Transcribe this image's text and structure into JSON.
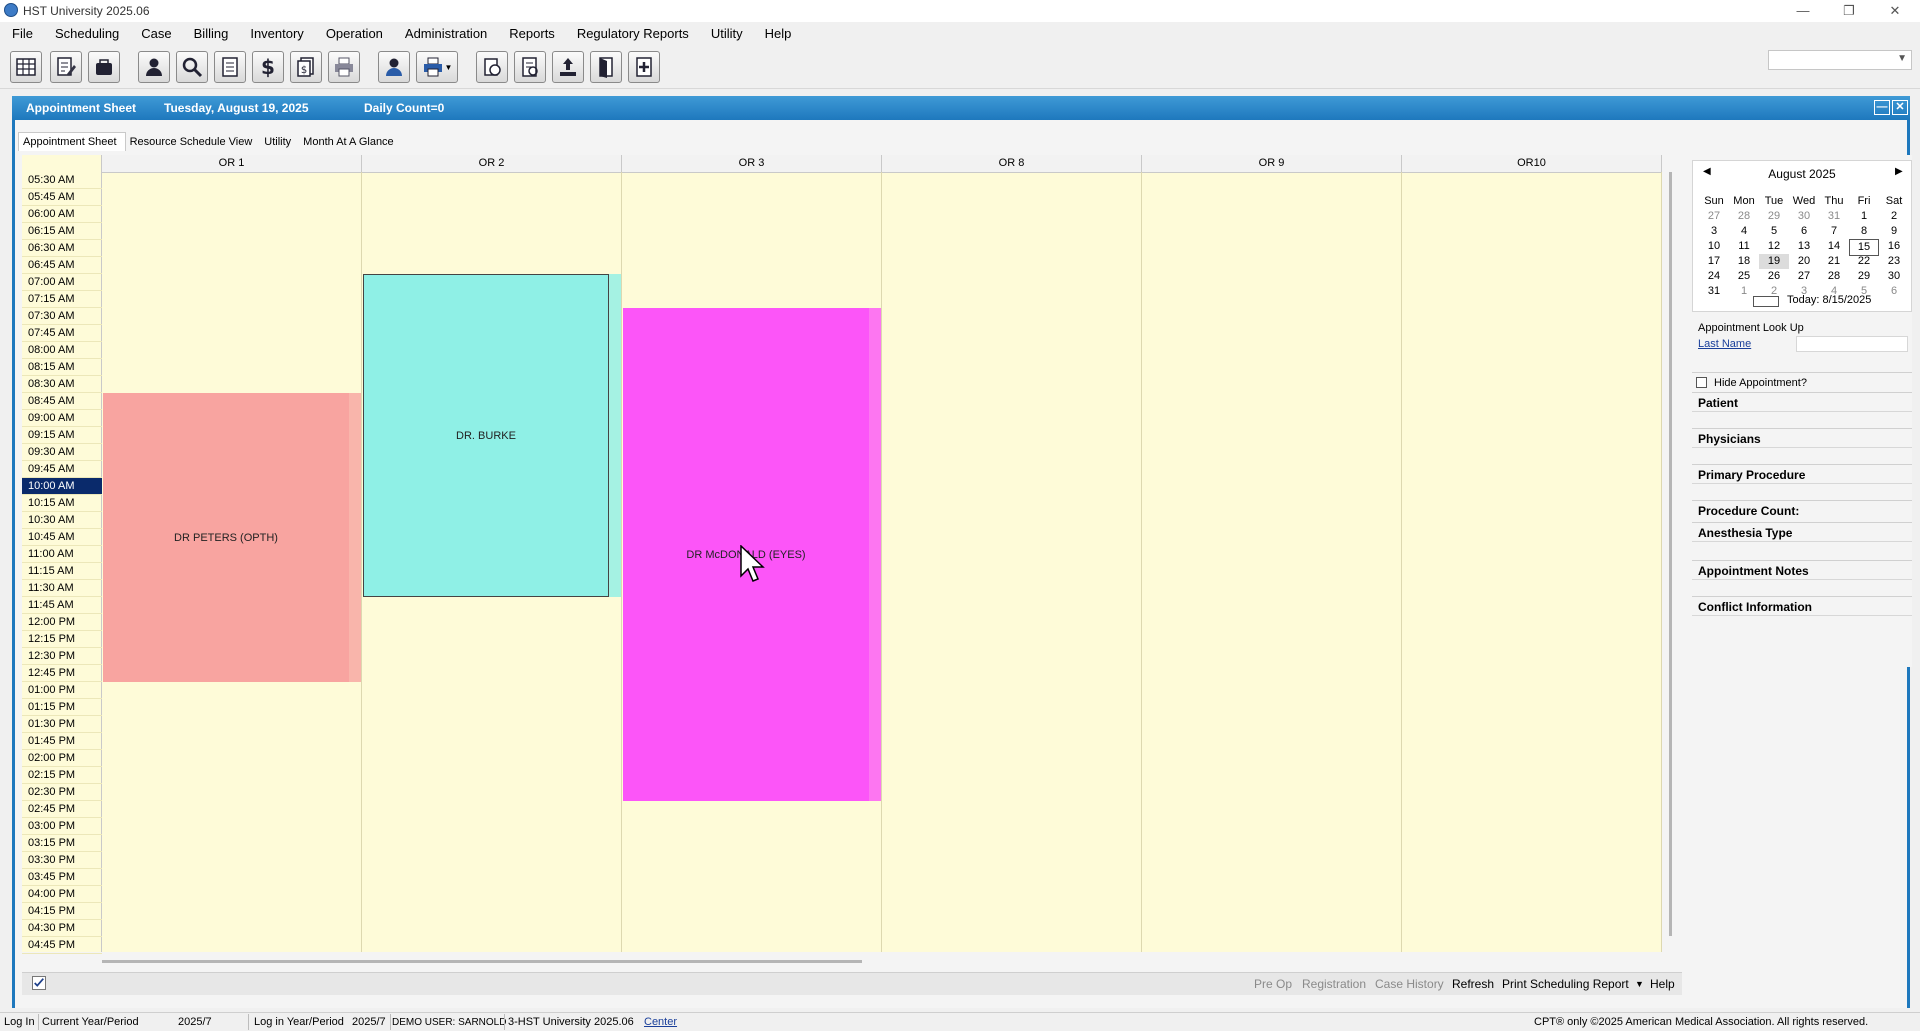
{
  "window": {
    "title": "HST University 2025.06"
  },
  "menu": [
    "File",
    "Scheduling",
    "Case",
    "Billing",
    "Inventory",
    "Operation",
    "Administration",
    "Reports",
    "Regulatory Reports",
    "Utility",
    "Help"
  ],
  "toolbar": {
    "icons": [
      "schedule-grid-icon",
      "edit-document-icon",
      "case-folder-icon",
      "patient-icon",
      "search-icon",
      "ledger-icon",
      "dollar-icon",
      "payments-icon",
      "print-icon",
      "physician-icon",
      "printer-dropdown-icon",
      "document-icon",
      "report-icon",
      "upload-icon",
      "exit-door-icon",
      "add-record-icon"
    ]
  },
  "appointment_sheet": {
    "header_title": "Appointment Sheet",
    "header_date": "Tuesday, August 19, 2025",
    "header_count": "Daily Count=0",
    "tabs": [
      "Appointment Sheet",
      "Resource Schedule View",
      "Utility",
      "Month At A Glance"
    ],
    "columns": [
      "OR 1",
      "OR 2",
      "OR 3",
      "OR 8",
      "OR 9",
      "OR10"
    ],
    "times": [
      "05:30 AM",
      "05:45 AM",
      "06:00 AM",
      "06:15 AM",
      "06:30 AM",
      "06:45 AM",
      "07:00 AM",
      "07:15 AM",
      "07:30 AM",
      "07:45 AM",
      "08:00 AM",
      "08:15 AM",
      "08:30 AM",
      "08:45 AM",
      "09:00 AM",
      "09:15 AM",
      "09:30 AM",
      "09:45 AM",
      "10:00 AM",
      "10:15 AM",
      "10:30 AM",
      "10:45 AM",
      "11:00 AM",
      "11:15 AM",
      "11:30 AM",
      "11:45 AM",
      "12:00 PM",
      "12:15 PM",
      "12:30 PM",
      "12:45 PM",
      "01:00 PM",
      "01:15 PM",
      "01:30 PM",
      "01:45 PM",
      "02:00 PM",
      "02:15 PM",
      "02:30 PM",
      "02:45 PM",
      "03:00 PM",
      "03:15 PM",
      "03:30 PM",
      "03:45 PM",
      "04:00 PM",
      "04:15 PM",
      "04:30 PM",
      "04:45 PM"
    ],
    "selected_time": "10:00 AM",
    "appointments": [
      {
        "label": "DR PETERS (OPTH)",
        "column": "OR 1",
        "start": "08:45 AM",
        "end": "01:00 PM",
        "color": "#f8a4a0"
      },
      {
        "label": "DR. BURKE",
        "column": "OR 2",
        "start": "07:00 AM",
        "end": "11:45 AM",
        "color": "#8ff0e6"
      },
      {
        "label": "DR McDONALD (EYES)",
        "column": "OR 3",
        "start": "07:30 AM",
        "end": "02:45 PM",
        "color": "#fc55f8"
      }
    ],
    "footer_links": {
      "preop": "Pre Op",
      "registration": "Registration",
      "case_history": "Case History",
      "refresh": "Refresh",
      "print_report": "Print Scheduling Report",
      "help": "Help"
    }
  },
  "calendar": {
    "month_label": "August 2025",
    "days_of_week": [
      "Sun",
      "Mon",
      "Tue",
      "Wed",
      "Thu",
      "Fri",
      "Sat"
    ],
    "weeks": [
      [
        "27",
        "28",
        "29",
        "30",
        "31",
        "1",
        "2"
      ],
      [
        "3",
        "4",
        "5",
        "6",
        "7",
        "8",
        "9"
      ],
      [
        "10",
        "11",
        "12",
        "13",
        "14",
        "15",
        "16"
      ],
      [
        "17",
        "18",
        "19",
        "20",
        "21",
        "22",
        "23"
      ],
      [
        "24",
        "25",
        "26",
        "27",
        "28",
        "29",
        "30"
      ],
      [
        "31",
        "1",
        "2",
        "3",
        "4",
        "5",
        "6"
      ]
    ],
    "today_label": "Today: 8/15/2025"
  },
  "lookup": {
    "title": "Appointment Look Up",
    "last_name_label": "Last Name",
    "last_name_value": ""
  },
  "details": {
    "hide_label": "Hide Appointment?",
    "fields": [
      "Patient",
      "Physicians",
      "Primary Procedure",
      "Procedure Count:",
      "Anesthesia Type",
      "Appointment Notes",
      "Conflict Information"
    ]
  },
  "statusbar": {
    "login": "Log In",
    "current_period_label": "Current Year/Period",
    "current_period_value": "2025/7",
    "login_period_label": "Log in Year/Period",
    "login_period_value": "2025/7",
    "user": "DEMO USER: SARNOLD",
    "facility": "3-HST University 2025.06",
    "center": "Center",
    "copyright": "CPT® only ©2025 American Medical Association. All rights reserved."
  },
  "colors": {
    "header_blue": "#1e78bd",
    "grid_bg": "#fefbd8",
    "selected_time": "#0a2a6b"
  }
}
